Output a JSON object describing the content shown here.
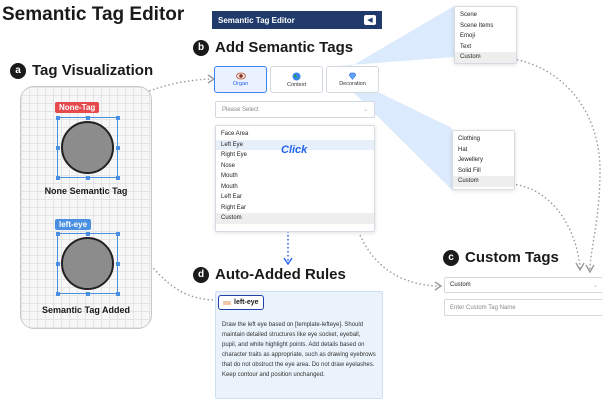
{
  "main_title": "Semantic Tag Editor",
  "panel_a": {
    "badge": "a",
    "title": "Tag Visualization",
    "none_tag": {
      "label": "None-Tag",
      "color": "#e5484d",
      "caption": "None Semantic Tag"
    },
    "added_tag": {
      "label": "left-eye",
      "color": "#4a90e2",
      "caption": "Semantic Tag Added"
    }
  },
  "editor_header": {
    "title": "Semantic Tag Editor",
    "collapse_icon": "chevron-left-icon"
  },
  "panel_b": {
    "badge": "b",
    "title": "Add Semantic Tags",
    "categories": [
      {
        "label": "Organ",
        "icon": "eye-icon",
        "active": true
      },
      {
        "label": "Context",
        "icon": "globe-icon",
        "active": false
      },
      {
        "label": "Decoration",
        "icon": "gem-icon",
        "active": false
      }
    ],
    "select_placeholder": "Please Select",
    "organ_options": [
      "Face Area",
      "Left Eye",
      "Right Eye",
      "Nose",
      "Mouth",
      "Mouth",
      "Left Ear",
      "Right Ear",
      "Custom"
    ],
    "click_label": "Click"
  },
  "context_menu": {
    "options": [
      "Scene",
      "Scene Items",
      "Emoji",
      "Text",
      "Custom"
    ]
  },
  "decoration_menu": {
    "options": [
      "Clothing",
      "Hat",
      "Jewellery",
      "Solid Fill",
      "Custom"
    ]
  },
  "panel_c": {
    "badge": "c",
    "title": "Custom Tags",
    "select_value": "Custom",
    "input_placeholder": "Enter Custom Tag Name"
  },
  "panel_d": {
    "badge": "d",
    "title": "Auto-Added Rules",
    "chip_label": "left-eye",
    "rule_text": "Draw the left eye based on [template-lefteye]. Should maintain detailed structures like eye socket, eyeball, pupil, and white highlight points. Add details based on character traits as appropriate, such as drawing eyebrows that do not obstruct the eye area. Do not draw eyelashes. Keep contour and position unchanged."
  },
  "colors": {
    "accent_blue": "#2563eb",
    "header_navy": "#1f3a6b",
    "none_tag_red": "#e5484d",
    "tag_blue": "#4a90e2"
  }
}
